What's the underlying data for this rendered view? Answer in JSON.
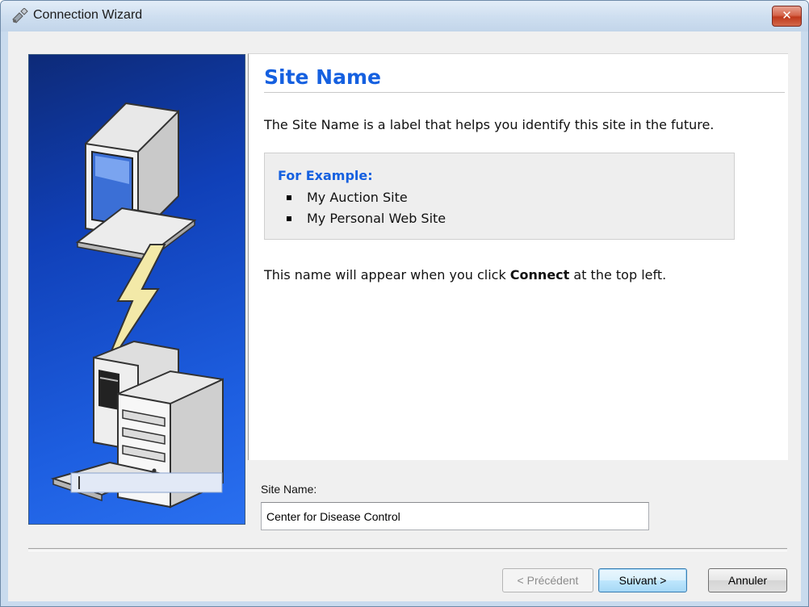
{
  "window": {
    "title": "Connection Wizard",
    "close_glyph": "✕"
  },
  "page": {
    "title": "Site Name",
    "description": "The Site Name is a label that helps you identify this site in the future.",
    "example": {
      "heading": "For Example:",
      "items": [
        "My Auction Site",
        "My Personal Web Site"
      ]
    },
    "note": {
      "before": "This name will appear when you click ",
      "bold": "Connect",
      "after": " at the top left."
    }
  },
  "field": {
    "label": "Site Name:",
    "value": "Center for Disease Control"
  },
  "buttons": {
    "back": "< Précédent",
    "next": "Suivant >",
    "cancel": "Annuler"
  },
  "colors": {
    "accent": "#1560e0",
    "side_panel": "#1040b8",
    "close_button": "#c0391c"
  },
  "icons": [
    "connection-wizard-icon",
    "close-icon",
    "network-illustration"
  ]
}
